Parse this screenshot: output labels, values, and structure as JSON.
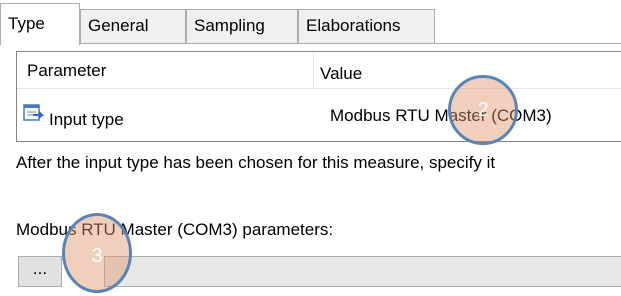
{
  "tabs": [
    {
      "label": "Type",
      "active": true
    },
    {
      "label": "General",
      "active": false
    },
    {
      "label": "Sampling",
      "active": false
    },
    {
      "label": "Elaborations",
      "active": false
    }
  ],
  "grid": {
    "columns": [
      "Parameter",
      "Value"
    ],
    "rows": [
      {
        "parameter": "Input type",
        "value": "Modbus RTU Master (COM3)",
        "icon": "input-type-icon"
      }
    ]
  },
  "description": "After the input type has been chosen for this measure, specify it",
  "params_label": "Modbus RTU Master (COM3) parameters:",
  "browse_label": "...",
  "callouts": [
    "2",
    "3"
  ],
  "colors": {
    "callout_fill": "#de966c",
    "callout_border": "#5b84b6",
    "tab_border": "#acacac",
    "tab_inactive_bg": "#f0f0f0"
  }
}
